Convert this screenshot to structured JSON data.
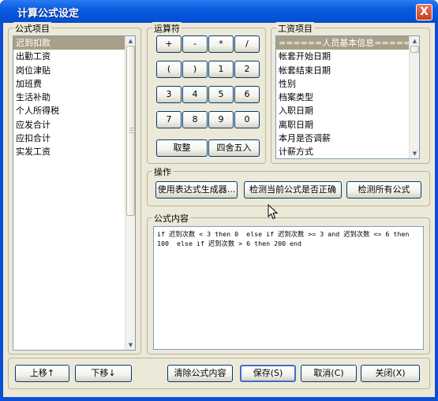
{
  "window": {
    "title": "计算公式设定",
    "close_glyph": "X"
  },
  "formula_items": {
    "label": "公式项目",
    "items": [
      "迟到扣款",
      "出勤工资",
      "岗位津贴",
      "加班费",
      "生活补助",
      "个人所得税",
      "应发合计",
      "应扣合计",
      "实发工资"
    ],
    "selected_index": 0
  },
  "operators": {
    "label": "运算符",
    "rows": [
      [
        "+",
        "-",
        "*",
        "/"
      ],
      [
        "(",
        ")",
        "1",
        "2"
      ],
      [
        "3",
        "4",
        "5",
        "6"
      ],
      [
        "7",
        "8",
        "9",
        "0"
      ]
    ],
    "round_down": "取整",
    "round_half": "四舍五入"
  },
  "salary_items": {
    "label": "工资项目",
    "items": [
      "======人员基本信息======",
      "帐套开始日期",
      "帐套结束日期",
      "性别",
      "档案类型",
      "入职日期",
      "离职日期",
      "本月是否调薪",
      "计薪方式"
    ],
    "selected_index": 0
  },
  "actions": {
    "label": "操作",
    "use_generator": "使用表达式生成器...",
    "check_current": "检测当前公式是否正确",
    "check_all": "检测所有公式"
  },
  "formula_content": {
    "label": "公式内容",
    "text": "if 迟到次数 < 3 then 0  else if 迟到次数 >= 3 and 迟到次数 <= 6 then 100  else if 迟到次数 > 6 then 200 end"
  },
  "footer": {
    "move_up": "上移↑",
    "move_down": "下移↓",
    "clear": "清除公式内容",
    "save": "保存(S)",
    "cancel": "取消(C)",
    "close": "关闭(X)"
  }
}
